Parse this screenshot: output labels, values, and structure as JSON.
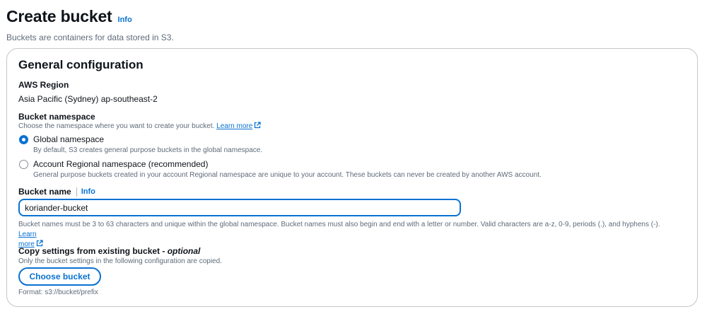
{
  "header": {
    "title": "Create bucket",
    "info": "Info",
    "description": "Buckets are containers for data stored in S3."
  },
  "general": {
    "title": "General configuration",
    "region_label": "AWS Region",
    "region_value": "Asia Pacific (Sydney) ap-southeast-2",
    "namespace_label": "Bucket namespace",
    "namespace_hint": "Choose the namespace where you want to create your bucket.",
    "learn_more": "Learn more",
    "options": [
      {
        "label": "Global namespace",
        "description": "By default, S3 creates general purpose buckets in the global namespace.",
        "checked": true
      },
      {
        "label": "Account Regional namespace (recommended)",
        "description": "General purpose buckets created in your account Regional namespace are unique to your account. These buckets can never be created by another AWS account.",
        "checked": false
      }
    ],
    "bucket_name_label": "Bucket name",
    "bucket_name_info": "Info",
    "bucket_name_value": "koriander-bucket",
    "bucket_name_hint": "Bucket names must be 3 to 63 characters and unique within the global namespace. Bucket names must also begin and end with a letter or number. Valid characters are a-z, 0-9, periods (.), and hyphens (-).",
    "learn_more_2a": "Learn",
    "learn_more_2b": "more",
    "copy_label": "Copy settings from existing bucket - ",
    "copy_optional": "optional",
    "copy_hint": "Only the bucket settings in the following configuration are copied.",
    "choose_button": "Choose bucket",
    "format_hint": "Format: s3://bucket/prefix"
  },
  "colors": {
    "accent": "#0972d3",
    "text": "#0f141a",
    "muted": "#5f6b7a",
    "border": "#c6c6cd"
  },
  "icons": [
    "external-link-icon",
    "radio-checked",
    "radio-unchecked"
  ]
}
